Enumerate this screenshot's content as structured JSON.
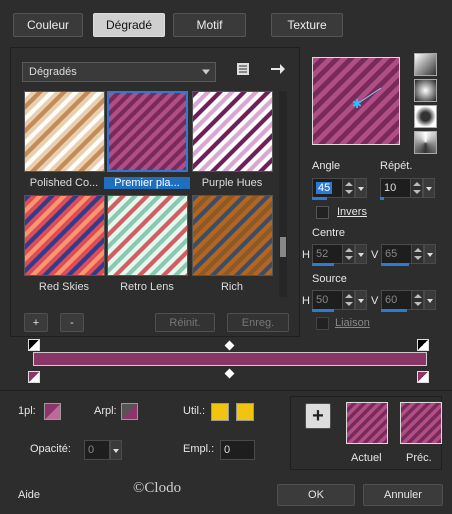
{
  "tabs": [
    {
      "label": "Couleur",
      "active": false
    },
    {
      "label": "Dégradé",
      "active": true
    },
    {
      "label": "Motif",
      "active": false
    },
    {
      "label": "Texture",
      "active": false
    }
  ],
  "gradient_list": {
    "selected": "Dégradés",
    "thumbnails": [
      {
        "label": "Polished Co...",
        "colors": [
          "#e8cfae",
          "#ffffff",
          "#c48a56"
        ],
        "selected": false
      },
      {
        "label": "Premier pla...",
        "colors": [
          "#7a2a5a",
          "#b04e85"
        ],
        "selected": true
      },
      {
        "label": "Purple Hues",
        "colors": [
          "#ffffff",
          "#6e1f5a",
          "#d9a7d1"
        ],
        "selected": false
      },
      {
        "label": "Red Skies",
        "colors": [
          "#e04a5a",
          "#2b3f8a",
          "#f59a6a"
        ],
        "selected": false
      },
      {
        "label": "Retro Lens",
        "colors": [
          "#e8f6ef",
          "#88c9b2",
          "#d06060"
        ],
        "selected": false
      },
      {
        "label": "Rich",
        "colors": [
          "#b5651d",
          "#3a4e6a",
          "#8a5a2a"
        ],
        "selected": false
      }
    ],
    "add_label": "+",
    "remove_label": "-",
    "reset_label": "Réinit.",
    "save_label": "Enreg."
  },
  "preview": {
    "colors": [
      "#7a2a5a",
      "#b04e85"
    ]
  },
  "angle": {
    "label": "Angle",
    "value": "45",
    "fill": 0.35
  },
  "repeat": {
    "label": "Répét.",
    "value": "10",
    "fill": 0.1
  },
  "invert": {
    "label": "Invers",
    "checked": false
  },
  "center": {
    "label": "Centre",
    "h_label": "H",
    "h_value": "52",
    "h_fill": 0.52,
    "v_label": "V",
    "v_value": "65",
    "v_fill": 0.65
  },
  "source": {
    "label": "Source",
    "h_label": "H",
    "h_value": "50",
    "h_fill": 0.5,
    "v_label": "V",
    "v_value": "60",
    "v_fill": 0.6
  },
  "link": {
    "label": "Liaison",
    "checked": false
  },
  "bottom": {
    "opacity_label": "1pl:",
    "arpl_label": "Arpl:",
    "util_label": "Util.:",
    "opacite_label": "Opacité:",
    "opacite_value": "0",
    "empl_label": "Empl.:",
    "empl_value": "0",
    "current_label": "Actuel",
    "prev_label": "Préc.",
    "help_label": "Aide",
    "ok_label": "OK",
    "cancel_label": "Annuler"
  },
  "watermark": "©Clodo",
  "colors": {
    "gradient_main": "#8c3568",
    "util_yellow": "#f1c40f"
  }
}
